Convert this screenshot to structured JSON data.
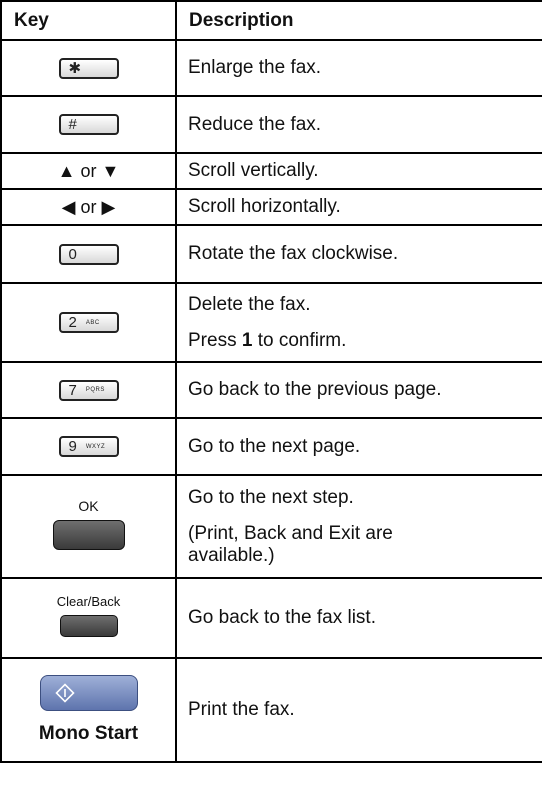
{
  "header": {
    "key": "Key",
    "description": "Description"
  },
  "rows": [
    {
      "key_label": "✱",
      "key_sub": "",
      "description": [
        "Enlarge the fax."
      ]
    },
    {
      "key_label": "#",
      "key_sub": "",
      "description": [
        "Reduce the fax."
      ]
    },
    {
      "key_text": "▲ or ▼",
      "description": [
        "Scroll vertically."
      ]
    },
    {
      "key_text": "◀ or ▶",
      "description": [
        "Scroll horizontally."
      ]
    },
    {
      "key_label": "0",
      "key_sub": "",
      "description": [
        "Rotate the fax clockwise."
      ]
    },
    {
      "key_label": "2",
      "key_sub": "ABC",
      "description": [
        "Delete the fax.",
        "Press ",
        "1",
        " to confirm."
      ]
    },
    {
      "key_label": "7",
      "key_sub": "PQRS",
      "description": [
        "Go back to the previous page."
      ]
    },
    {
      "key_label": "9",
      "key_sub": "WXYZ",
      "description": [
        "Go to the next page."
      ]
    },
    {
      "key_caption": "OK",
      "description": [
        "Go to the next step.",
        "(Print, Back and Exit are available.)"
      ]
    },
    {
      "key_caption": "Clear/Back",
      "description": [
        "Go back to the fax list."
      ]
    },
    {
      "key_caption": "Mono Start",
      "description": [
        "Print the fax."
      ]
    }
  ]
}
